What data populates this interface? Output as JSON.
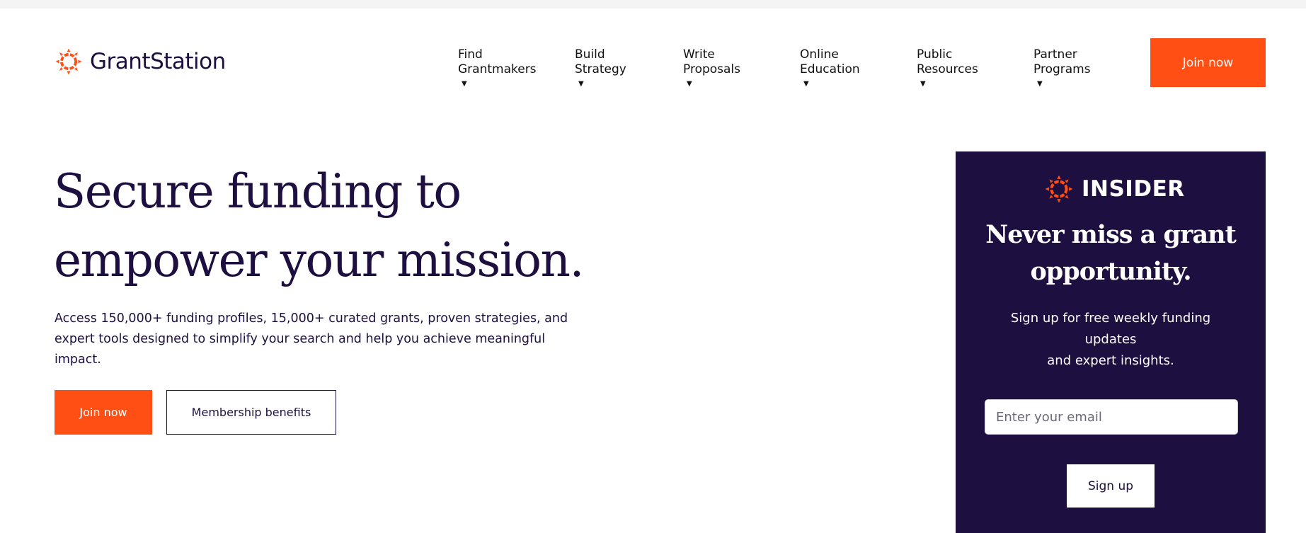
{
  "header": {
    "brand": "GrantStation",
    "join_label": "Join now",
    "nav": [
      {
        "line1": "Find",
        "line2": "Grantmakers"
      },
      {
        "line1": "Build",
        "line2": "Strategy"
      },
      {
        "line1": "Write",
        "line2": "Proposals"
      },
      {
        "line1": "Online",
        "line2": "Education"
      },
      {
        "line1": "Public",
        "line2": "Resources"
      },
      {
        "line1": "Partner",
        "line2": "Programs"
      }
    ]
  },
  "hero": {
    "title_line1": "Secure funding to",
    "title_line2": "empower your mission.",
    "description": "Access 150,000+ funding profiles, 15,000+ curated grants, proven strategies, and expert tools designed to simplify your search and help you achieve meaningful impact.",
    "join_label": "Join now",
    "benefits_label": "Membership benefits"
  },
  "insider": {
    "brand": "INSIDER",
    "title_line1": "Never miss a grant",
    "title_line2": "opportunity.",
    "subtitle_line1": "Sign up for free weekly funding updates",
    "subtitle_line2": "and expert insights.",
    "email_placeholder": "Enter your email",
    "signup_label": "Sign up"
  },
  "icons": {
    "logo": "sunburst-logo-icon",
    "caret": "caret-down-icon"
  },
  "colors": {
    "accent": "#ff4f15",
    "navy": "#1d0f40",
    "text": "#1d1040",
    "background": "#ffffff"
  }
}
